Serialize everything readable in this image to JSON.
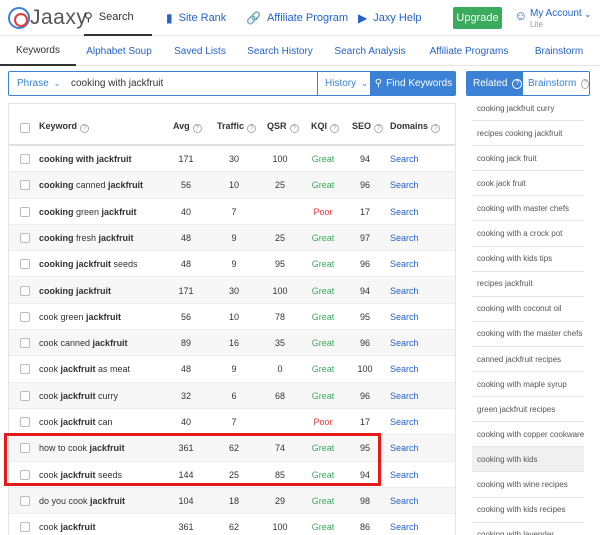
{
  "app": {
    "logo_text": "Jaaxy",
    "colors": {
      "accent": "#3b82d6",
      "brand_red": "#e63b3b",
      "upgrade": "#3aaa5c",
      "great": "#3aaa5c",
      "poor": "#e63b3b",
      "highlight": "#e8191a"
    }
  },
  "topnav": {
    "items": [
      {
        "label": "Search",
        "icon": "search-icon",
        "active": true
      },
      {
        "label": "Site Rank",
        "icon": "bar-chart-icon"
      },
      {
        "label": "Affiliate Program",
        "icon": "link-icon"
      },
      {
        "label": "Jaxy Help",
        "icon": "play-circle-icon"
      }
    ],
    "upgrade_label": "Upgrade",
    "account": {
      "label": "My Account",
      "level": "Lite",
      "icon": "user-icon"
    }
  },
  "subtabs": [
    "Keywords",
    "Alphabet Soup",
    "Saved Lists",
    "Search History",
    "Search Analysis",
    "Affiliate Programs",
    "Brainstorm"
  ],
  "searchbar": {
    "phrase_label": "Phrase",
    "query": "cooking with jackfruit",
    "history_label": "History",
    "find_label": "Find Keywords"
  },
  "table": {
    "columns": [
      "Keyword",
      "Avg",
      "Traffic",
      "QSR",
      "KQI",
      "SEO",
      "Domains"
    ],
    "rows": [
      {
        "kw": [
          [
            "cooking with jackfruit",
            true
          ]
        ],
        "avg": "171",
        "traffic": "30",
        "qsr": "100",
        "kqi": "Great",
        "seo": "94",
        "dom": "Search"
      },
      {
        "kw": [
          [
            "cooking",
            true
          ],
          [
            " canned ",
            false
          ],
          [
            "jackfruit",
            true
          ]
        ],
        "avg": "56",
        "traffic": "10",
        "qsr": "25",
        "kqi": "Great",
        "seo": "96",
        "dom": "Search"
      },
      {
        "kw": [
          [
            "cooking",
            true
          ],
          [
            " green ",
            false
          ],
          [
            "jackfruit",
            true
          ]
        ],
        "avg": "40",
        "traffic": "7",
        "qsr": "",
        "kqi": "Poor",
        "seo": "17",
        "dom": "Search"
      },
      {
        "kw": [
          [
            "cooking",
            true
          ],
          [
            " fresh ",
            false
          ],
          [
            "jackfruit",
            true
          ]
        ],
        "avg": "48",
        "traffic": "9",
        "qsr": "25",
        "kqi": "Great",
        "seo": "97",
        "dom": "Search"
      },
      {
        "kw": [
          [
            "cooking jackfruit",
            true
          ],
          [
            " seeds",
            false
          ]
        ],
        "avg": "48",
        "traffic": "9",
        "qsr": "95",
        "kqi": "Great",
        "seo": "96",
        "dom": "Search"
      },
      {
        "kw": [
          [
            "cooking jackfruit",
            true
          ]
        ],
        "avg": "171",
        "traffic": "30",
        "qsr": "100",
        "kqi": "Great",
        "seo": "94",
        "dom": "Search"
      },
      {
        "kw": [
          [
            "cook green ",
            false
          ],
          [
            "jackfruit",
            true
          ]
        ],
        "avg": "56",
        "traffic": "10",
        "qsr": "78",
        "kqi": "Great",
        "seo": "95",
        "dom": "Search"
      },
      {
        "kw": [
          [
            "cook canned ",
            false
          ],
          [
            "jackfruit",
            true
          ]
        ],
        "avg": "89",
        "traffic": "16",
        "qsr": "35",
        "kqi": "Great",
        "seo": "96",
        "dom": "Search"
      },
      {
        "kw": [
          [
            "cook ",
            false
          ],
          [
            "jackfruit",
            true
          ],
          [
            " as meat",
            false
          ]
        ],
        "avg": "48",
        "traffic": "9",
        "qsr": "0",
        "kqi": "Great",
        "seo": "100",
        "dom": "Search"
      },
      {
        "kw": [
          [
            "cook ",
            false
          ],
          [
            "jackfruit",
            true
          ],
          [
            " curry",
            false
          ]
        ],
        "avg": "32",
        "traffic": "6",
        "qsr": "68",
        "kqi": "Great",
        "seo": "96",
        "dom": "Search"
      },
      {
        "kw": [
          [
            "cook ",
            false
          ],
          [
            "jackfruit",
            true
          ],
          [
            " can",
            false
          ]
        ],
        "avg": "40",
        "traffic": "7",
        "qsr": "",
        "kqi": "Poor",
        "seo": "17",
        "dom": "Search"
      },
      {
        "kw": [
          [
            "how to cook ",
            false
          ],
          [
            "jackfruit",
            true
          ]
        ],
        "avg": "361",
        "traffic": "62",
        "qsr": "74",
        "kqi": "Great",
        "seo": "95",
        "dom": "Search"
      },
      {
        "kw": [
          [
            "cook ",
            false
          ],
          [
            "jackfruit",
            true
          ],
          [
            " seeds",
            false
          ]
        ],
        "avg": "144",
        "traffic": "25",
        "qsr": "85",
        "kqi": "Great",
        "seo": "94",
        "dom": "Search"
      },
      {
        "kw": [
          [
            "do you cook ",
            false
          ],
          [
            "jackfruit",
            true
          ]
        ],
        "avg": "104",
        "traffic": "18",
        "qsr": "29",
        "kqi": "Great",
        "seo": "98",
        "dom": "Search"
      },
      {
        "kw": [
          [
            "cook ",
            false
          ],
          [
            "jackfruit",
            true
          ]
        ],
        "avg": "361",
        "traffic": "62",
        "qsr": "100",
        "kqi": "Great",
        "seo": "86",
        "dom": "Search"
      }
    ]
  },
  "related": {
    "tab_related": "Related",
    "tab_brainstorm": "Brainstorm",
    "items": [
      "cooking jackfruit curry",
      "recipes cooking jackfruit",
      "cooking jack fruit",
      "cook jack fruit",
      "cooking with master chefs",
      "cooking with a crock pot",
      "cooking with kids tips",
      "recipes jackfruit",
      "cooking with coconut oil",
      "cooking with the master chefs",
      "canned jackfruit recipes",
      "cooking with maple syrup",
      "green jackfruit recipes",
      "cooking with copper cookware",
      "cooking with kids",
      "cooking with wine recipes",
      "cooking with kids recipes",
      "cooking with lavender"
    ]
  }
}
